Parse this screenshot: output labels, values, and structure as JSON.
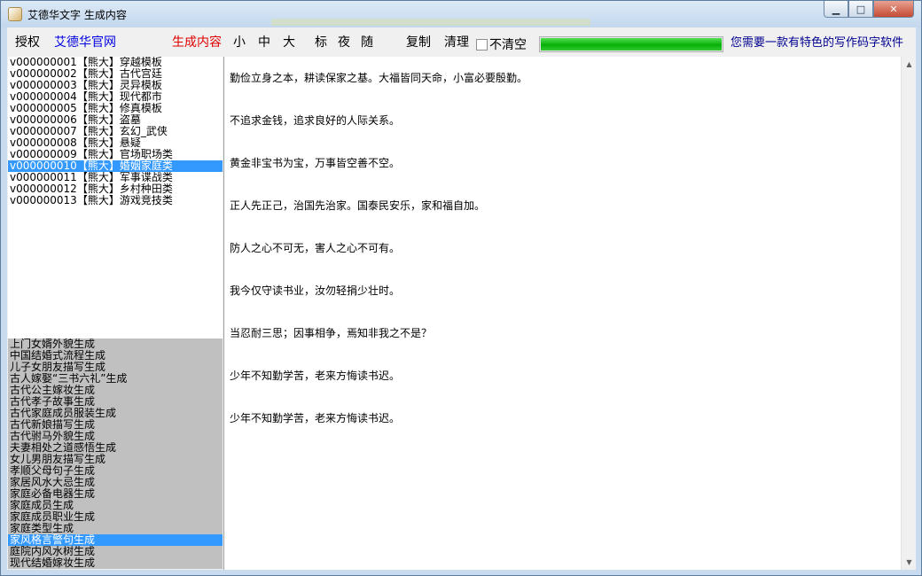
{
  "window": {
    "title": "艾德华文字 生成内容",
    "buttons": {
      "minimize": "▁",
      "maximize": "□",
      "close": "✕"
    }
  },
  "toolbar": {
    "license": "授权",
    "official_site": "艾德华官网",
    "generate_content": "生成内容",
    "size_small": "小",
    "size_medium": "中",
    "size_large": "大",
    "theme_standard": "标",
    "theme_night": "夜",
    "theme_random": "随",
    "copy": "复制",
    "clear": "清理",
    "no_clear_label": "不清空",
    "no_clear_checked": false,
    "progress_percent": 100,
    "slogan": "您需要一款有特色的写作码字软件"
  },
  "template_list": {
    "selected_index": 9,
    "items": [
      "v000000001【熊大】穿越模板",
      "v000000002【熊大】古代宫廷",
      "v000000003【熊大】灵异模板",
      "v000000004【熊大】现代都市",
      "v000000005【熊大】修真模板",
      "v000000006【熊大】盗墓",
      "v000000007【熊大】玄幻_武侠",
      "v000000008【熊大】悬疑",
      "v000000009【熊大】官场职场类",
      "v000000010【熊大】婚姻家庭类",
      "v000000011【熊大】军事谍战类",
      "v000000012【熊大】乡村种田类",
      "v000000013【熊大】游戏竞技类"
    ]
  },
  "generator_list": {
    "selected_index": 17,
    "items": [
      "上门女婿外貌生成",
      "中国结婚式流程生成",
      "儿子女朋友描写生成",
      "古人嫁娶“三书六礼”生成",
      "古代公主嫁妆生成",
      "古代孝子故事生成",
      "古代家庭成员服装生成",
      "古代新娘描写生成",
      "古代驸马外貌生成",
      "夫妻相处之道感悟生成",
      "女儿男朋友描写生成",
      "孝顺父母句子生成",
      "家居风水大忌生成",
      "家庭必备电器生成",
      "家庭成员生成",
      "家庭成员职业生成",
      "家庭类型生成",
      "家风格言警句生成",
      "庭院内风水树生成",
      "现代结婚嫁妆生成"
    ]
  },
  "content": {
    "paragraphs": [
      "勤俭立身之本，耕读保家之基。大福皆同天命，小富必要殷勤。",
      "不追求金钱，追求良好的人际关系。",
      "黄金非宝书为宝，万事皆空善不空。",
      "正人先正己，治国先治家。国泰民安乐，家和福自加。",
      "防人之心不可无，害人之心不可有。",
      "我今仅守读书业，汝勿轻捐少壮时。",
      "当忍耐三思；因事相争，焉知非我之不是？",
      "少年不知勤学苦，老来方悔读书迟。",
      "少年不知勤学苦，老来方悔读书迟。"
    ]
  },
  "colors": {
    "link_blue": "#0000e0",
    "active_red": "#e00000",
    "selection": "#3399ff",
    "progress_green": "#06b006"
  }
}
